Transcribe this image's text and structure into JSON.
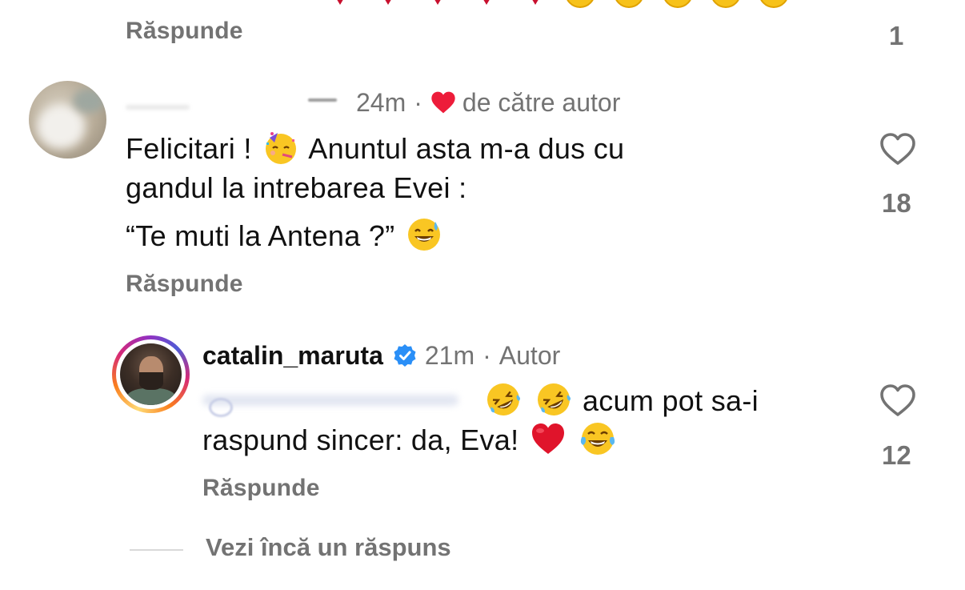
{
  "comment_prev": {
    "reply_label": "Răspunde",
    "like_count": "1"
  },
  "comment1": {
    "time": "24m",
    "liked_by_label": "de către autor",
    "text_line1": "Felicitari !",
    "text_line1b": "Anuntul asta m-a dus cu",
    "text_line2": "gandul la intrebarea Evei :",
    "text_line3": "“Te muti la Antena ?”",
    "reply_label": "Răspunde",
    "like_count": "18"
  },
  "comment2": {
    "username": "catalin_maruta",
    "time": "21m",
    "author_label": "Autor",
    "text_line1": "acum pot sa-i",
    "text_line2": "raspund sincer: da, Eva!",
    "reply_label": "Răspunde",
    "like_count": "12"
  },
  "see_more_label": "Vezi încă un răspuns",
  "icons": {
    "heart_outline": "heart-outline-icon",
    "heart_filled": "heart-filled-icon",
    "verified": "verified-badge-icon"
  },
  "colors": {
    "secondary_text": "#737373",
    "like_red": "#ed1c3a",
    "verified_blue": "#2a8ff7"
  }
}
